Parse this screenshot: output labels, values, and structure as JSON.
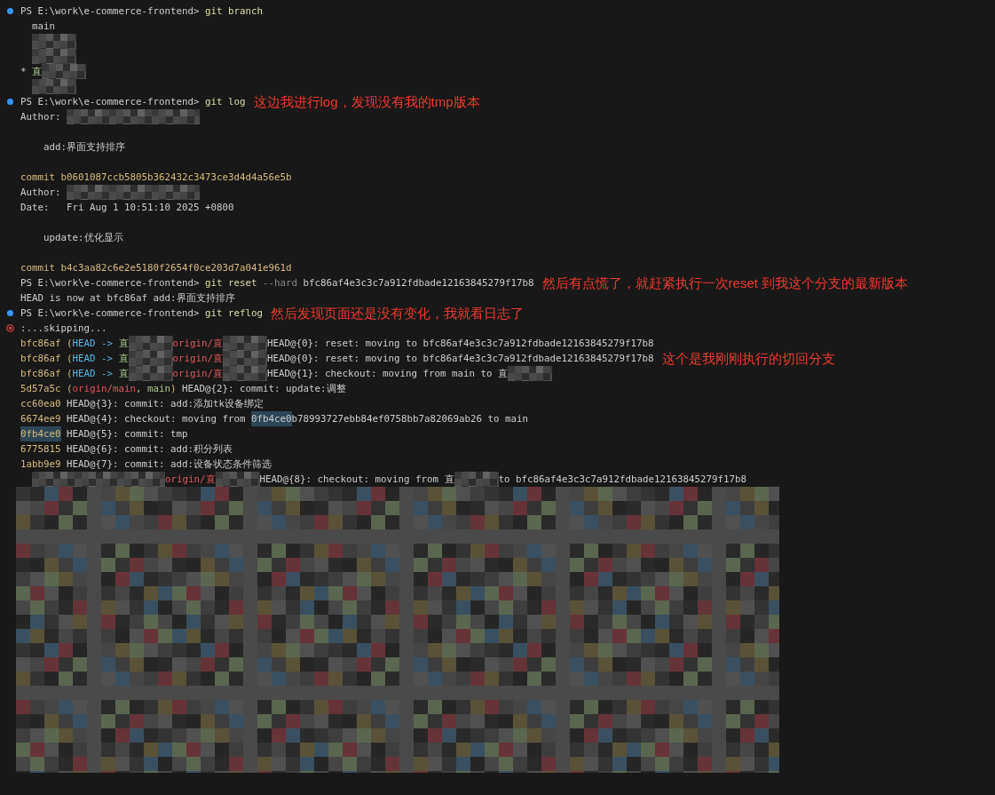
{
  "terminal": {
    "lines": [
      {
        "kind": "prompt",
        "segments": [
          {
            "kind": "prompt",
            "text": "PS E:\\work\\e-commerce-frontend> "
          },
          {
            "kind": "command",
            "text": "git branch"
          }
        ]
      },
      {
        "kind": "output",
        "segments": [
          {
            "kind": "plain",
            "text": "  main"
          }
        ]
      },
      {
        "kind": "output",
        "segments": [
          {
            "kind": "redacted-short"
          }
        ]
      },
      {
        "kind": "output",
        "segments": [
          {
            "kind": "redacted-short"
          }
        ]
      },
      {
        "kind": "output",
        "segments": [
          {
            "kind": "plain",
            "text": "* "
          },
          {
            "kind": "branch",
            "text": "直"
          },
          {
            "kind": "redacted-short"
          }
        ]
      },
      {
        "kind": "output",
        "segments": [
          {
            "kind": "redacted-short"
          }
        ]
      },
      {
        "kind": "prompt",
        "segments": [
          {
            "kind": "prompt",
            "text": "PS E:\\work\\e-commerce-frontend> "
          },
          {
            "kind": "command",
            "text": "git log"
          }
        ],
        "note": "这边我进行log，发现没有我的tmp版本"
      },
      {
        "kind": "output",
        "segments": [
          {
            "kind": "plain",
            "text": "Author: "
          },
          {
            "kind": "redacted-long"
          }
        ]
      },
      {
        "kind": "blank"
      },
      {
        "kind": "output",
        "segments": [
          {
            "kind": "plain",
            "text": "    add:界面支持排序"
          }
        ]
      },
      {
        "kind": "blank"
      },
      {
        "kind": "output",
        "segments": [
          {
            "kind": "hash",
            "text": "commit b0601087ccb5805b362432c3473ce3d4d4a56e5b"
          }
        ]
      },
      {
        "kind": "output",
        "segments": [
          {
            "kind": "plain",
            "text": "Author: "
          },
          {
            "kind": "redacted-long"
          }
        ]
      },
      {
        "kind": "output",
        "segments": [
          {
            "kind": "plain",
            "text": "Date:   Fri Aug 1 10:51:10 2025 +0800"
          }
        ]
      },
      {
        "kind": "blank"
      },
      {
        "kind": "output",
        "segments": [
          {
            "kind": "plain",
            "text": "    update:优化显示"
          }
        ]
      },
      {
        "kind": "blank"
      },
      {
        "kind": "output",
        "segments": [
          {
            "kind": "hash",
            "text": "commit b4c3aa82c6e2e5180f2654f0ce203d7a041e961d"
          }
        ]
      },
      {
        "kind": "output",
        "segments": [
          {
            "kind": "prompt",
            "text": "PS E:\\work\\e-commerce-frontend> "
          },
          {
            "kind": "command",
            "text": "git reset "
          },
          {
            "kind": "flag",
            "text": "--hard"
          },
          {
            "kind": "plain",
            "text": " bfc86af4e3c3c7a912fdbade12163845279f17b8"
          }
        ],
        "note": "然后有点慌了，就赶紧执行一次reset 到我这个分支的最新版本"
      },
      {
        "kind": "output",
        "segments": [
          {
            "kind": "plain",
            "text": "HEAD is now at bfc86af add:界面支持排序"
          }
        ]
      },
      {
        "kind": "prompt",
        "segments": [
          {
            "kind": "prompt",
            "text": "PS E:\\work\\e-commerce-frontend> "
          },
          {
            "kind": "command",
            "text": "git reflog"
          }
        ],
        "note": "然后发现页面还是没有变化，我就看日志了"
      },
      {
        "kind": "error",
        "segments": [
          {
            "kind": "plain",
            "text": ":...skipping..."
          }
        ]
      },
      {
        "kind": "output",
        "segments": [
          {
            "kind": "hash",
            "text": "bfc86af ("
          },
          {
            "kind": "head",
            "text": "HEAD -> "
          },
          {
            "kind": "branch",
            "text": "直"
          },
          {
            "kind": "redacted-short"
          },
          {
            "kind": "remote",
            "text": "origin/直"
          },
          {
            "kind": "redacted-short"
          },
          {
            "kind": "plain",
            "text": "HEAD@{0}: reset: moving to bfc86af4e3c3c7a912fdbade12163845279f17b8"
          }
        ]
      },
      {
        "kind": "output",
        "segments": [
          {
            "kind": "hash",
            "text": "bfc86af ("
          },
          {
            "kind": "head",
            "text": "HEAD -> "
          },
          {
            "kind": "branch",
            "text": "直"
          },
          {
            "kind": "redacted-short"
          },
          {
            "kind": "remote",
            "text": "origin/直"
          },
          {
            "kind": "redacted-short"
          },
          {
            "kind": "plain",
            "text": "HEAD@{0}: reset: moving to bfc86af4e3c3c7a912fdbade12163845279f17b8"
          }
        ],
        "note": "这个是我刚刚执行的切回分支"
      },
      {
        "kind": "output",
        "segments": [
          {
            "kind": "hash",
            "text": "bfc86af ("
          },
          {
            "kind": "head",
            "text": "HEAD -> "
          },
          {
            "kind": "branch",
            "text": "直"
          },
          {
            "kind": "redacted-short"
          },
          {
            "kind": "remote",
            "text": "origin/直"
          },
          {
            "kind": "redacted-short"
          },
          {
            "kind": "plain",
            "text": "HEAD@{1}: checkout: moving from main to 直"
          },
          {
            "kind": "redacted-short"
          }
        ]
      },
      {
        "kind": "output",
        "segments": [
          {
            "kind": "hash",
            "text": "5d57a5c ("
          },
          {
            "kind": "remote",
            "text": "origin/main"
          },
          {
            "kind": "hash",
            "text": ", "
          },
          {
            "kind": "branch",
            "text": "main"
          },
          {
            "kind": "hash",
            "text": ")"
          },
          {
            "kind": "plain",
            "text": " HEAD@{2}: commit: update:调整"
          }
        ]
      },
      {
        "kind": "output",
        "segments": [
          {
            "kind": "hash",
            "text": "cc60ea0"
          },
          {
            "kind": "plain",
            "text": " HEAD@{3}: commit: add:添加tk设备绑定"
          }
        ]
      },
      {
        "kind": "output",
        "segments": [
          {
            "kind": "hash",
            "text": "6674ee9"
          },
          {
            "kind": "plain",
            "text": " HEAD@{4}: checkout: moving from "
          },
          {
            "kind": "plain",
            "text": "0fb4ce0",
            "highlighted": true
          },
          {
            "kind": "plain",
            "text": "b78993727ebb84ef0758bb7a82069ab26 to main"
          }
        ]
      },
      {
        "kind": "output",
        "segments": [
          {
            "kind": "hash",
            "text": "0fb4ce0",
            "highlighted": true
          },
          {
            "kind": "plain",
            "text": " HEAD@{5}: commit: tmp"
          }
        ]
      },
      {
        "kind": "output",
        "segments": [
          {
            "kind": "hash",
            "text": "6775815"
          },
          {
            "kind": "plain",
            "text": " HEAD@{6}: commit: add:积分列表"
          }
        ]
      },
      {
        "kind": "output",
        "segments": [
          {
            "kind": "hash",
            "text": "1abb9e9"
          },
          {
            "kind": "plain",
            "text": " HEAD@{7}: commit: add:设备状态条件筛选"
          }
        ]
      },
      {
        "kind": "output",
        "segments": [
          {
            "kind": "redacted-long"
          },
          {
            "kind": "remote",
            "text": "origin/直"
          },
          {
            "kind": "redacted-short"
          },
          {
            "kind": "plain",
            "text": "HEAD@{8}: checkout: moving from 直"
          },
          {
            "kind": "redacted-short"
          },
          {
            "kind": "plain",
            "text": "to bfc86af4e3c3c7a912fdbade12163845279f17b8"
          }
        ]
      },
      {
        "kind": "obscured"
      }
    ]
  }
}
